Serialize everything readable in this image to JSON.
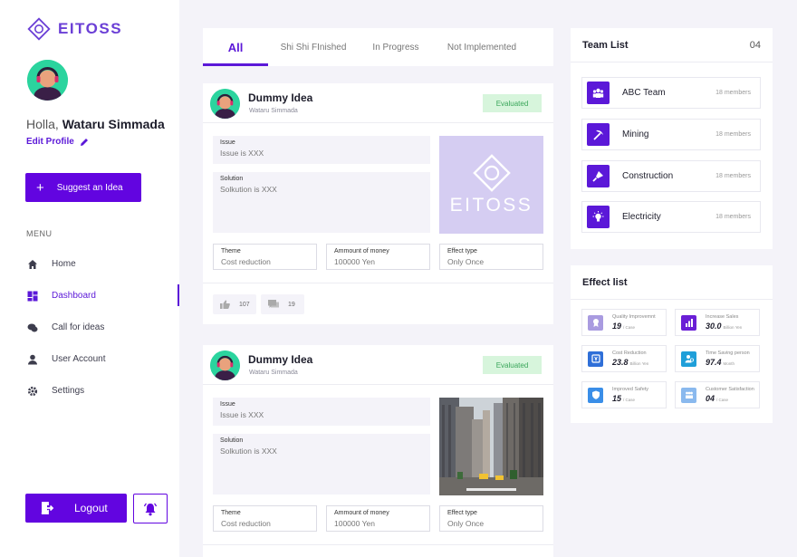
{
  "brand": {
    "name": "EITOSS",
    "color": "#6205e0"
  },
  "user": {
    "greeting": "Holla,",
    "name": "Wataru Simmada",
    "edit_profile": "Edit Profile"
  },
  "suggest_button": "Suggest an Idea",
  "menu": {
    "label": "MENU",
    "items": [
      {
        "label": "Home",
        "icon": "home-icon",
        "active": false
      },
      {
        "label": "Dashboard",
        "icon": "dashboard-icon",
        "active": true
      },
      {
        "label": "Call for ideas",
        "icon": "chat-icon",
        "active": false
      },
      {
        "label": "User Account",
        "icon": "user-icon",
        "active": false
      },
      {
        "label": "Settings",
        "icon": "gear-icon",
        "active": false
      }
    ]
  },
  "logout_button": "Logout",
  "tabs": [
    "All",
    "Shi Shi FInished",
    "In Progress",
    "Not Implemented"
  ],
  "ideas": [
    {
      "title": "Dummy Idea",
      "author": "Wataru Simmada",
      "status": "Evaluated",
      "issue_label": "Issue",
      "issue": "Issue is XXX",
      "solution_label": "Solution",
      "solution": "Solkution is XXX",
      "theme_label": "Theme",
      "theme": "Cost reduction",
      "money_label": "Ammount of money",
      "money": "100000 Yen",
      "effect_label": "Effect type",
      "effect": "Only Once",
      "image_text": "EITOSS",
      "likes": "107",
      "comments": "19"
    },
    {
      "title": "Dummy Idea",
      "author": "Wataru Simmada",
      "status": "Evaluated",
      "issue_label": "Issue",
      "issue": "Issue is XXX",
      "solution_label": "Solution",
      "solution": "Solkution is XXX",
      "theme_label": "Theme",
      "theme": "Cost reduction",
      "money_label": "Ammount of money",
      "money": "100000 Yen",
      "effect_label": "Effect type",
      "effect": "Only Once"
    }
  ],
  "team_list": {
    "title": "Team List",
    "count": "04",
    "teams": [
      {
        "name": "ABC Team",
        "members": "18 members",
        "icon": "team-icon"
      },
      {
        "name": "Mining",
        "members": "18 members",
        "icon": "pickaxe-icon"
      },
      {
        "name": "Construction",
        "members": "18 members",
        "icon": "trowel-icon"
      },
      {
        "name": "Electricity",
        "members": "18 members",
        "icon": "bulb-icon"
      }
    ]
  },
  "effect_list": {
    "title": "Effect list",
    "items": [
      {
        "name": "Quality Improvemnt",
        "value": "19",
        "unit": "/ Case",
        "color": "#a99be0",
        "icon": "medal-icon"
      },
      {
        "name": "Increase Sales",
        "value": "30.0",
        "unit": "Billion Yen",
        "color": "#6a1fd6",
        "icon": "bar-chart-icon"
      },
      {
        "name": "Cost Reduction",
        "value": "23.8",
        "unit": "Billion Yen",
        "color": "#2f6fd8",
        "icon": "yen-icon"
      },
      {
        "name": "Time Saving person",
        "value": "97.4",
        "unit": "Month",
        "color": "#1f9fd9",
        "icon": "person-clock-icon"
      },
      {
        "name": "Improved Safety",
        "value": "15",
        "unit": "/ Case",
        "color": "#3a8ee8",
        "icon": "shield-icon"
      },
      {
        "name": "Customer Satisfaction",
        "value": "04",
        "unit": "/ Case",
        "color": "#8ab9ee",
        "icon": "group-icon"
      }
    ]
  }
}
